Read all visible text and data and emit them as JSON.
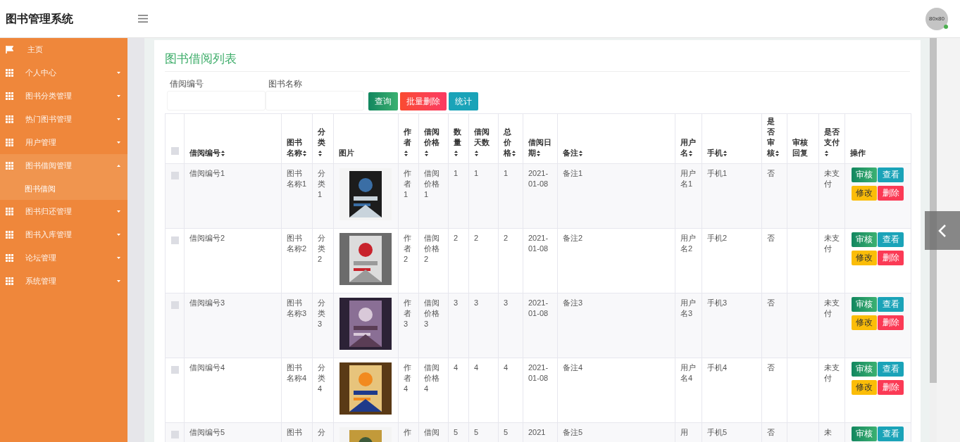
{
  "app_title": "图书管理系统",
  "avatar": {
    "text": "80x80",
    "online": true
  },
  "sidebar": {
    "items": [
      {
        "label": "主页",
        "kind": "home",
        "selected": false
      },
      {
        "label": "个人中心",
        "kind": "group",
        "expanded": false,
        "selected": false
      },
      {
        "label": "图书分类管理",
        "kind": "group",
        "expanded": false,
        "selected": false
      },
      {
        "label": "热门图书管理",
        "kind": "group",
        "expanded": false,
        "selected": false
      },
      {
        "label": "用户管理",
        "kind": "group",
        "expanded": false,
        "selected": false
      },
      {
        "label": "图书借阅管理",
        "kind": "group",
        "expanded": true,
        "selected": true,
        "children": [
          {
            "label": "图书借阅"
          }
        ]
      },
      {
        "label": "图书归还管理",
        "kind": "group",
        "expanded": false,
        "selected": false
      },
      {
        "label": "图书入库管理",
        "kind": "group",
        "expanded": false,
        "selected": false
      },
      {
        "label": "论坛管理",
        "kind": "group",
        "expanded": false,
        "selected": false
      },
      {
        "label": "系统管理",
        "kind": "group",
        "expanded": false,
        "selected": false
      }
    ]
  },
  "page_title": "图书借阅列表",
  "search": {
    "fields": [
      {
        "label": "借阅编号"
      },
      {
        "label": "图书名称"
      }
    ],
    "buttons": [
      {
        "label": "查询",
        "kind": "search"
      },
      {
        "label": "批量删除",
        "kind": "delete"
      },
      {
        "label": "统计",
        "kind": "stats"
      }
    ]
  },
  "table": {
    "select_all": {
      "checked": false
    },
    "columns": [
      {
        "label": "借阅编号",
        "sortable": true
      },
      {
        "label": "图书名称",
        "sortable": true
      },
      {
        "label": "分类",
        "sortable": true
      },
      {
        "label": "图片",
        "sortable": false
      },
      {
        "label": "作者",
        "sortable": true
      },
      {
        "label": "借阅价格",
        "sortable": true
      },
      {
        "label": "数量",
        "sortable": true
      },
      {
        "label": "借阅天数",
        "sortable": true
      },
      {
        "label": "总价格",
        "sortable": true
      },
      {
        "label": "借阅日期",
        "sortable": true
      },
      {
        "label": "备注",
        "sortable": true
      },
      {
        "label": "用户名",
        "sortable": true
      },
      {
        "label": "手机",
        "sortable": true
      },
      {
        "label": "是否审核",
        "sortable": true
      },
      {
        "label": "审核回复",
        "sortable": false
      },
      {
        "label": "是否支付",
        "sortable": true
      },
      {
        "label": "操作",
        "sortable": false
      }
    ],
    "rows": [
      {
        "checked": false,
        "cells": [
          "借阅编号1",
          "图书名称1",
          "分类1",
          "",
          "作者1",
          "借阅价格1",
          "1",
          "1",
          "1",
          "2021-01-08",
          "备注1",
          "用户名1",
          "手机1",
          "否",
          "",
          "未支付"
        ],
        "actions": [
          {
            "label": "审核",
            "kind": "audit"
          },
          {
            "label": "查看",
            "kind": "view"
          },
          {
            "label": "修改",
            "kind": "edit"
          },
          {
            "label": "删除",
            "kind": "delete"
          }
        ]
      },
      {
        "checked": false,
        "cells": [
          "借阅编号2",
          "图书名称2",
          "分类2",
          "",
          "作者2",
          "借阅价格2",
          "2",
          "2",
          "2",
          "2021-01-08",
          "备注2",
          "用户名2",
          "手机2",
          "否",
          "",
          "未支付"
        ],
        "actions": [
          {
            "label": "审核",
            "kind": "audit"
          },
          {
            "label": "查看",
            "kind": "view"
          },
          {
            "label": "修改",
            "kind": "edit"
          },
          {
            "label": "删除",
            "kind": "delete"
          }
        ]
      },
      {
        "checked": false,
        "cells": [
          "借阅编号3",
          "图书名称3",
          "分类3",
          "",
          "作者3",
          "借阅价格3",
          "3",
          "3",
          "3",
          "2021-01-08",
          "备注3",
          "用户名3",
          "手机3",
          "否",
          "",
          "未支付"
        ],
        "actions": [
          {
            "label": "审核",
            "kind": "audit"
          },
          {
            "label": "查看",
            "kind": "view"
          },
          {
            "label": "修改",
            "kind": "edit"
          },
          {
            "label": "删除",
            "kind": "delete"
          }
        ]
      },
      {
        "checked": false,
        "cells": [
          "借阅编号4",
          "图书名称4",
          "分类4",
          "",
          "作者4",
          "借阅价格4",
          "4",
          "4",
          "4",
          "2021-01-08",
          "备注4",
          "用户名4",
          "手机4",
          "否",
          "",
          "未支付"
        ],
        "actions": [
          {
            "label": "审核",
            "kind": "audit"
          },
          {
            "label": "查看",
            "kind": "view"
          },
          {
            "label": "修改",
            "kind": "edit"
          },
          {
            "label": "删除",
            "kind": "delete"
          }
        ]
      },
      {
        "checked": false,
        "cells": [
          "借阅编号5",
          "图书",
          "分",
          "",
          "作",
          "借阅",
          "5",
          "5",
          "5",
          "2021",
          "备注5",
          "用",
          "手机5",
          "否",
          "",
          "未"
        ],
        "actions": [
          {
            "label": "审核",
            "kind": "audit"
          },
          {
            "label": "查看",
            "kind": "view"
          }
        ]
      }
    ]
  }
}
